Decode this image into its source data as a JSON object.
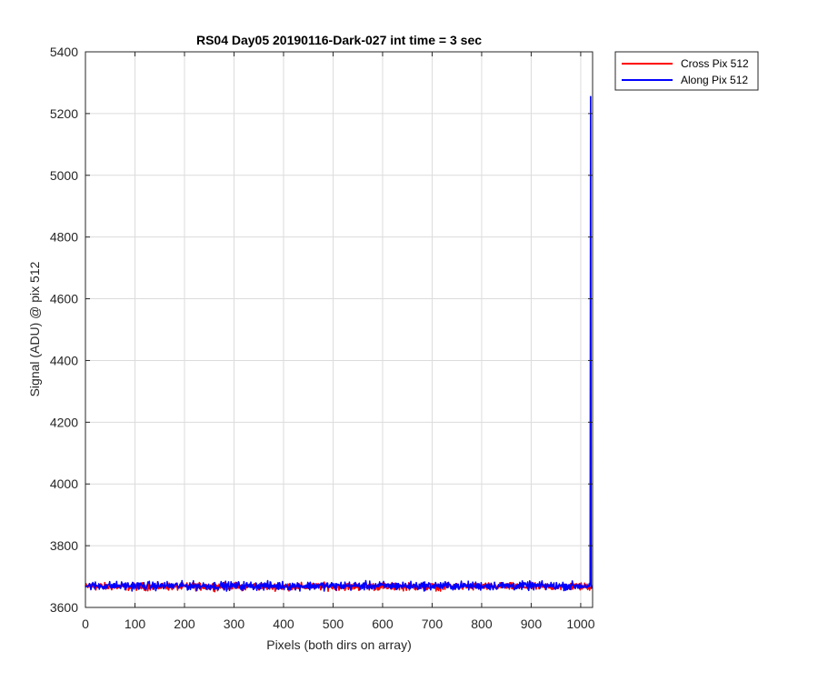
{
  "chart_data": {
    "type": "line",
    "title": "RS04 Day05 20190116-Dark-027 int time = 3 sec",
    "xlabel": "Pixels (both dirs on array)",
    "ylabel": "Signal (ADU) @ pix 512",
    "xlim": [
      0,
      1024
    ],
    "ylim": [
      3600,
      5400
    ],
    "xticks": [
      0,
      100,
      200,
      300,
      400,
      500,
      600,
      700,
      800,
      900,
      1000
    ],
    "yticks": [
      3600,
      3800,
      4000,
      4200,
      4400,
      4600,
      4800,
      5000,
      5200,
      5400
    ],
    "grid": true,
    "legend_position": "outside top-right",
    "series": [
      {
        "name": "Cross Pix 512",
        "color": "#ff0000",
        "baseline": 3668,
        "noise_range": [
          3650,
          3685
        ],
        "x_end": 1023
      },
      {
        "name": "Along Pix 512",
        "color": "#0000ff",
        "baseline": 3668,
        "noise_range": [
          3650,
          3690
        ],
        "x_end": 1023,
        "spike": {
          "x": 1020,
          "y": 5255
        }
      }
    ]
  }
}
